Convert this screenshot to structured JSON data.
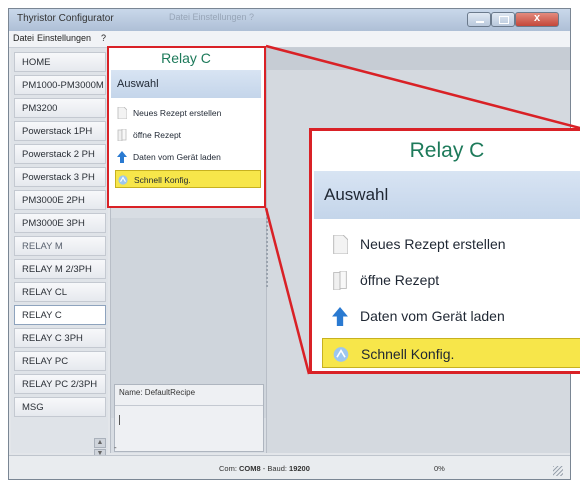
{
  "window": {
    "title": "Thyristor Configurator",
    "ghost_title": "Datei  Einstellungen  ?"
  },
  "menu": [
    "Datei",
    "Einstellungen",
    "?"
  ],
  "sidebar": {
    "items": [
      {
        "label": "HOME"
      },
      {
        "label": "PM1000-PM3000M"
      },
      {
        "label": "PM3200"
      },
      {
        "label": "Powerstack 1PH"
      },
      {
        "label": "Powerstack 2 PH"
      },
      {
        "label": "Powerstack 3 PH"
      },
      {
        "label": "PM3000E  2PH"
      },
      {
        "label": "PM3000E  3PH"
      },
      {
        "label": "RELAY M"
      },
      {
        "label": "RELAY M 2/3PH"
      },
      {
        "label": "RELAY CL"
      },
      {
        "label": "RELAY C"
      },
      {
        "label": "RELAY C 3PH"
      },
      {
        "label": "RELAY PC"
      },
      {
        "label": "RELAY PC 2/3PH"
      },
      {
        "label": "MSG"
      }
    ],
    "selected": "RELAY C"
  },
  "panel": {
    "name_label": "Name: DefaultRecipe",
    "bottom_mark": "-"
  },
  "popup": {
    "title": "Relay C",
    "section": "Auswahl",
    "items": [
      {
        "label": "Neues Rezept erstellen",
        "icon": "new-document-icon"
      },
      {
        "label": "öffne Rezept",
        "icon": "open-document-icon"
      },
      {
        "label": "Daten vom Gerät laden",
        "icon": "arrow-up-icon"
      },
      {
        "label": "Schnell Konfig.",
        "icon": "quick-config-icon",
        "highlighted": true
      }
    ]
  },
  "status": {
    "com_prefix": "Com: ",
    "com_value": "COM8",
    "baud_prefix": " - Baud: ",
    "baud_value": "19200",
    "progress": "0%"
  },
  "colors": {
    "accent_red": "#d92126",
    "title_green": "#1d7a5a",
    "highlight_yellow": "#f7e64a",
    "section_blue": "#c4d5ea"
  }
}
